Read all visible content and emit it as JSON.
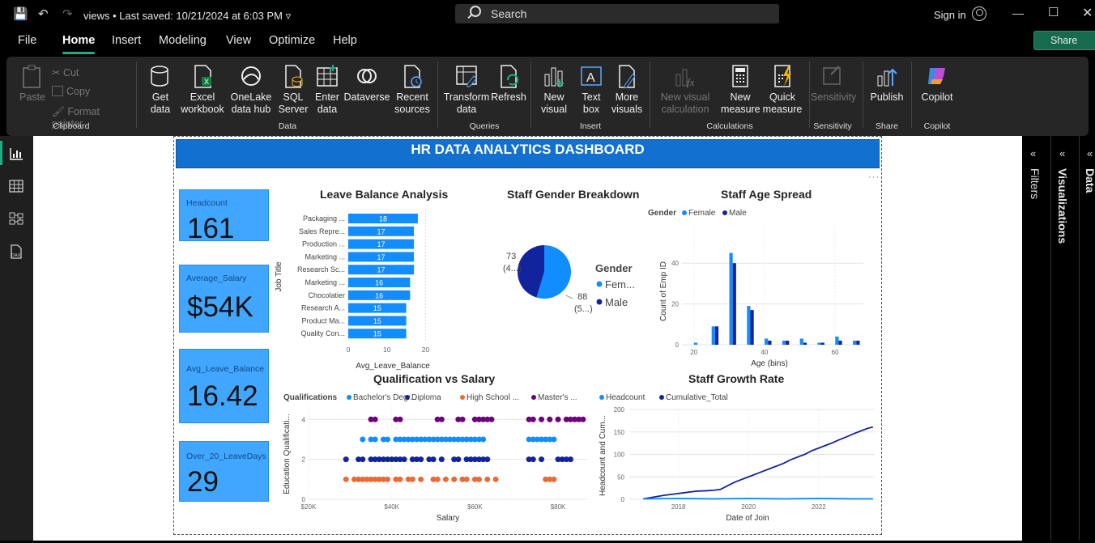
{
  "titlebar": {
    "doc_name": "views",
    "saved": "Last saved: 10/21/2024 at 6:03 PM",
    "search": "Search",
    "signin": "Sign in"
  },
  "menu": [
    "File",
    "Home",
    "Insert",
    "Modeling",
    "View",
    "Optimize",
    "Help"
  ],
  "share_label": "Share",
  "ribbon": {
    "clipboard": {
      "label": "Clipboard",
      "paste": "Paste",
      "cut": "Cut",
      "copy": "Copy",
      "format_painter": "Format painter"
    },
    "data": {
      "label": "Data",
      "get_data": "Get data",
      "excel": "Excel workbook",
      "onelake": "OneLake data hub",
      "sql": "SQL Server",
      "enter": "Enter data",
      "dataverse": "Dataverse",
      "recent": "Recent sources"
    },
    "queries": {
      "label": "Queries",
      "transform": "Transform data",
      "refresh": "Refresh"
    },
    "insert": {
      "label": "Insert",
      "new_visual": "New visual",
      "text_box": "Text box",
      "more_visuals": "More visuals"
    },
    "calculations": {
      "label": "Calculations",
      "new_visual_calc": "New visual calculation",
      "new_measure": "New measure",
      "quick_measure": "Quick measure"
    },
    "sensitivity": {
      "label": "Sensitivity",
      "btn": "Sensitivity"
    },
    "share": {
      "label": "Share",
      "publish": "Publish"
    },
    "copilot": {
      "label": "Copilot",
      "btn": "Copilot"
    }
  },
  "right_panes": {
    "filters": "Filters",
    "visualizations": "Visualizations",
    "data": "Data"
  },
  "dashboard": {
    "title": "HR DATA ANALYTICS DASHBOARD",
    "kpis": [
      {
        "label": "Headcount",
        "value": "161"
      },
      {
        "label": "Average_Salary",
        "value": "$54K"
      },
      {
        "label": "Avg_Leave_Balance",
        "value": "16.42"
      },
      {
        "label": "Over_20_LeaveDays",
        "value": "29"
      }
    ]
  },
  "colors": {
    "accent": "#1ab086",
    "light_blue": "#118dff",
    "dark_blue": "#12239e",
    "orange": "#e66c37",
    "purple": "#6b007b",
    "banner": "#1170d0",
    "kpi": "#41a6ff"
  },
  "chart_data": [
    {
      "type": "bar",
      "title": "Leave Balance Analysis",
      "ylabel": "Job Title",
      "xlabel": "Avg_Leave_Balance",
      "categories": [
        "Packaging ...",
        "Sales Repre...",
        "Production ...",
        "Marketing ...",
        "Research Sc...",
        "Marketing ...",
        "Chocolatier",
        "Research A...",
        "Product Ma...",
        "Quality Con..."
      ],
      "values": [
        18,
        17,
        17,
        17,
        17,
        16,
        16,
        15,
        15,
        15
      ],
      "xticks": [
        "0",
        "10",
        "20"
      ],
      "xlim": [
        0,
        22
      ]
    },
    {
      "type": "pie",
      "title": "Staff Gender Breakdown",
      "legend_title": "Gender",
      "slices": [
        {
          "name": "Female",
          "value": 88,
          "label": "88",
          "pct_label": "(5...)"
        },
        {
          "name": "Male",
          "value": 73,
          "label": "73",
          "pct_label": "(4...)"
        }
      ],
      "legend": [
        "Fem...",
        "Male"
      ]
    },
    {
      "type": "bar",
      "title": "Staff Age Spread",
      "legend_title": "Gender",
      "legend": [
        "Female",
        "Male"
      ],
      "xlabel": "Age (bins)",
      "ylabel": "Count of Emp ID",
      "bins": [
        19,
        24,
        29,
        34,
        39,
        44,
        49,
        54,
        59,
        64
      ],
      "series": [
        {
          "name": "Female",
          "values": [
            1,
            9,
            45,
            19,
            3,
            2,
            3,
            1,
            4,
            2
          ]
        },
        {
          "name": "Male",
          "values": [
            0,
            9,
            40,
            17,
            2,
            2,
            1,
            1,
            2,
            2
          ]
        }
      ],
      "yticks": [
        "0",
        "20",
        "40"
      ],
      "xticks": [
        "20",
        "40",
        "60"
      ],
      "ylim": [
        0,
        50
      ],
      "xlim": [
        18,
        68
      ]
    },
    {
      "type": "scatter",
      "title": "Qualification vs Salary",
      "legend_title": "Qualifications",
      "legend": [
        "Bachelor's Degr...",
        "Diploma",
        "High School ...",
        "Master's ..."
      ],
      "xlabel": "Salary",
      "ylabel": "Education Qualificati...",
      "xticks": [
        "$20K",
        "$40K",
        "$60K",
        "$80K"
      ],
      "yticks": [
        "0",
        "2",
        "4"
      ],
      "xlim": [
        20,
        87
      ],
      "ylim": [
        0,
        4.7
      ],
      "series": [
        {
          "name": "Bachelor's Degree",
          "y": 3,
          "x": [
            33,
            35,
            36,
            38,
            39,
            41,
            42,
            43,
            44,
            45,
            46,
            47,
            48,
            49,
            50,
            51,
            52,
            53,
            54,
            55,
            56,
            57,
            58,
            59,
            60,
            61,
            62,
            73,
            74,
            75,
            76,
            77,
            78,
            79
          ]
        },
        {
          "name": "Diploma",
          "y": 2,
          "x": [
            29,
            32,
            33,
            35,
            36,
            37,
            38,
            39,
            40,
            41,
            42,
            43,
            45,
            46,
            47,
            49,
            50,
            52,
            55,
            56,
            58,
            59,
            60,
            61,
            62,
            63,
            73,
            74,
            76,
            80,
            81,
            82,
            83
          ]
        },
        {
          "name": "High School",
          "y": 1,
          "x": [
            29,
            31,
            32,
            33,
            34,
            35,
            36,
            37,
            38,
            39,
            41,
            42,
            44,
            45,
            47,
            50,
            51,
            53,
            55,
            57,
            58,
            60,
            61,
            63,
            65,
            77,
            78,
            79
          ]
        },
        {
          "name": "Master's",
          "y": 4,
          "x": [
            35,
            36,
            41,
            42,
            51,
            52,
            56,
            57,
            60,
            61,
            62,
            63,
            64,
            73,
            74,
            76,
            78,
            80,
            82,
            83,
            84,
            85,
            86
          ]
        }
      ]
    },
    {
      "type": "line",
      "title": "Staff Growth Rate",
      "legend": [
        "Headcount",
        "Cumulative_Total"
      ],
      "xlabel": "Date of Join",
      "ylabel": "Headcount and Cum...",
      "xticks": [
        "2018",
        "2020",
        "2022"
      ],
      "yticks": [
        "0",
        "50",
        "100",
        "150",
        "200"
      ],
      "ylim": [
        0,
        200
      ],
      "xlim": [
        2016.6,
        2023.6
      ],
      "series": [
        {
          "name": "Cumulative_Total",
          "points": [
            [
              2017.0,
              1
            ],
            [
              2017.3,
              5
            ],
            [
              2017.6,
              9
            ],
            [
              2017.9,
              12
            ],
            [
              2018.2,
              15
            ],
            [
              2018.5,
              18
            ],
            [
              2018.8,
              19
            ],
            [
              2019.0,
              20
            ],
            [
              2019.2,
              22
            ],
            [
              2019.4,
              30
            ],
            [
              2019.6,
              38
            ],
            [
              2019.8,
              44
            ],
            [
              2020.0,
              50
            ],
            [
              2020.2,
              56
            ],
            [
              2020.4,
              62
            ],
            [
              2020.6,
              68
            ],
            [
              2020.8,
              74
            ],
            [
              2021.0,
              80
            ],
            [
              2021.2,
              88
            ],
            [
              2021.4,
              94
            ],
            [
              2021.6,
              100
            ],
            [
              2021.8,
              108
            ],
            [
              2022.0,
              114
            ],
            [
              2022.2,
              120
            ],
            [
              2022.4,
              126
            ],
            [
              2022.6,
              133
            ],
            [
              2022.8,
              139
            ],
            [
              2023.0,
              146
            ],
            [
              2023.2,
              152
            ],
            [
              2023.4,
              158
            ],
            [
              2023.55,
              161
            ]
          ]
        },
        {
          "name": "Headcount",
          "points": [
            [
              2017.0,
              1
            ],
            [
              2018.0,
              2
            ],
            [
              2019.0,
              1
            ],
            [
              2020.0,
              2
            ],
            [
              2021.0,
              1
            ],
            [
              2022.0,
              2
            ],
            [
              2023.0,
              1
            ],
            [
              2023.55,
              1
            ]
          ]
        }
      ]
    }
  ]
}
